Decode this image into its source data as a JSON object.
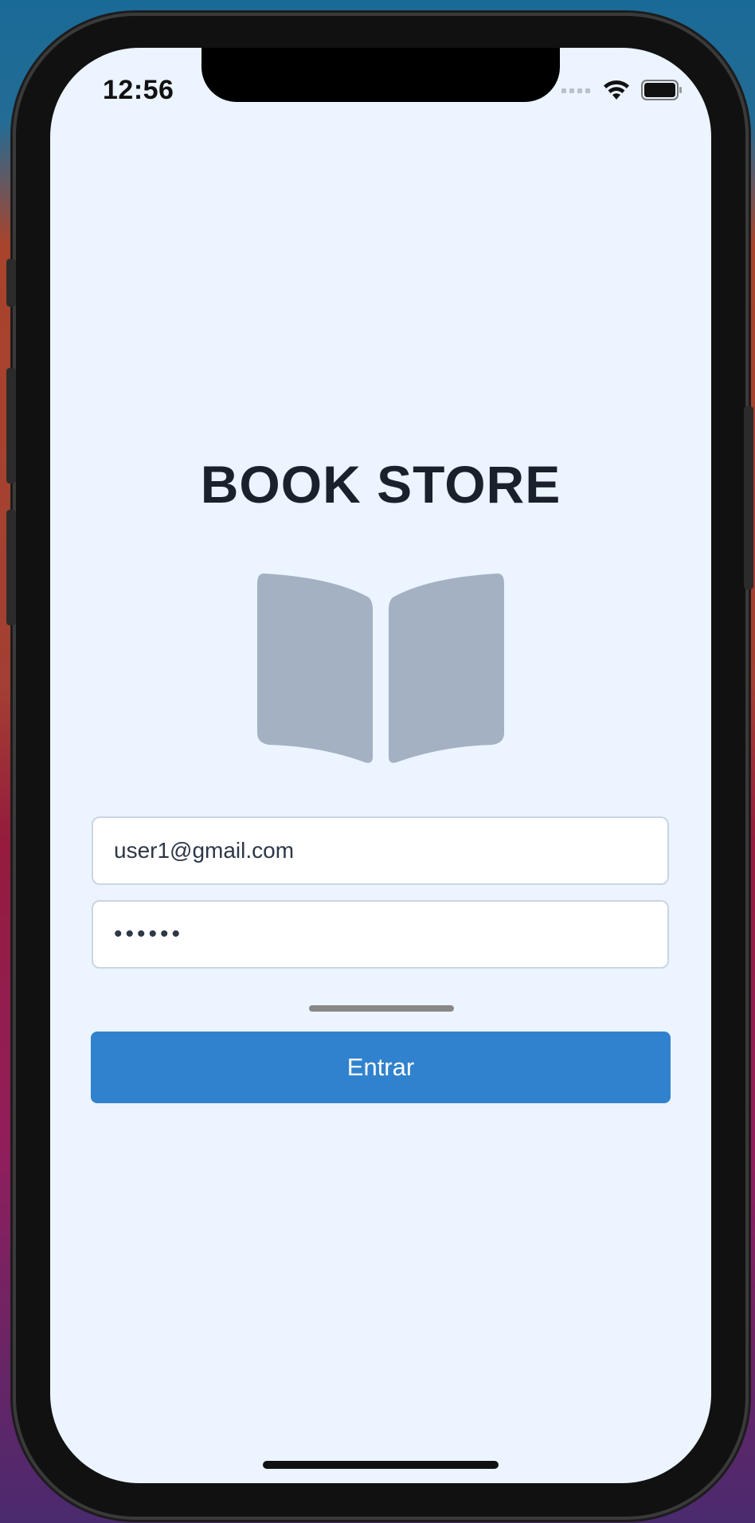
{
  "status_bar": {
    "time": "12:56",
    "signal_icon": "cellular-signal-icon",
    "wifi_icon": "wifi-icon",
    "battery_icon": "battery-icon"
  },
  "login": {
    "title": "BOOK STORE",
    "logo_icon": "open-book-icon",
    "email_value": "user1@gmail.com",
    "password_value": "••••••",
    "submit_label": "Entrar"
  },
  "colors": {
    "background": "#ebf4ff",
    "title": "#1a202c",
    "icon": "#a3b1c2",
    "button": "#3182ce",
    "button_text": "#ffffff",
    "field_border": "#cbd5e0"
  }
}
